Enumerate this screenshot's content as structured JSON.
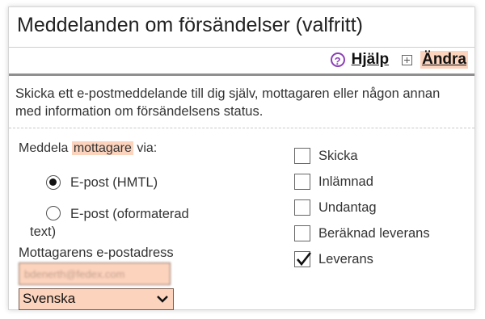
{
  "header": {
    "title": "Meddelanden om försändelser (valfritt)"
  },
  "links": {
    "help": "Hjälp",
    "edit": "Ändra"
  },
  "description": "Skicka ett e-postmeddelande till dig själv, mottagaren eller någon annan med information om försändelsens status.",
  "notify": {
    "prefix": "Meddela",
    "highlight": "mottagare",
    "suffix": "via:"
  },
  "format_options": [
    {
      "label": "E-post (HMTL)",
      "selected": true
    },
    {
      "label_line1": "E-post (oformaterad",
      "label_line2": "text)",
      "selected": false
    }
  ],
  "email": {
    "label": "Mottagarens e-postadress",
    "value": "bdenerth@fedex.com"
  },
  "language": {
    "selected": "Svenska"
  },
  "events": [
    {
      "label": "Skicka",
      "checked": false
    },
    {
      "label": "Inlämnad",
      "checked": false
    },
    {
      "label": "Undantag",
      "checked": false
    },
    {
      "label": "Beräknad leverans",
      "checked": false
    },
    {
      "label": "Leverans",
      "checked": true
    }
  ],
  "colors": {
    "highlight": "#fcd3bd",
    "help_icon": "#8b3fb6"
  }
}
